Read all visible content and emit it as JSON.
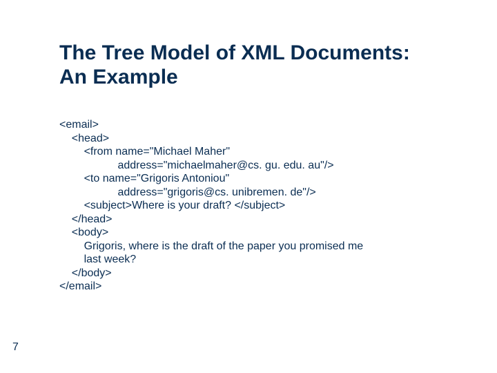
{
  "title_line1": "The Tree Model of XML Documents:",
  "title_line2": "An Example",
  "code": {
    "l01": "<email>",
    "l02": "    <head>",
    "l03": "        <from name=\"Michael Maher\"",
    "l04": "                   address=\"michaelmaher@cs. gu. edu. au\"/>",
    "l05": "        <to name=\"Grigoris Antoniou\"",
    "l06": "                   address=\"grigoris@cs. unibremen. de\"/>",
    "l07": "        <subject>Where is your draft? </subject>",
    "l08": "    </head>",
    "l09": "    <body>",
    "l10": "        Grigoris, where is the draft of the paper you promised me",
    "l11": "        last week?",
    "l12": "    </body>",
    "l13": "</email>"
  },
  "page_number": "7"
}
